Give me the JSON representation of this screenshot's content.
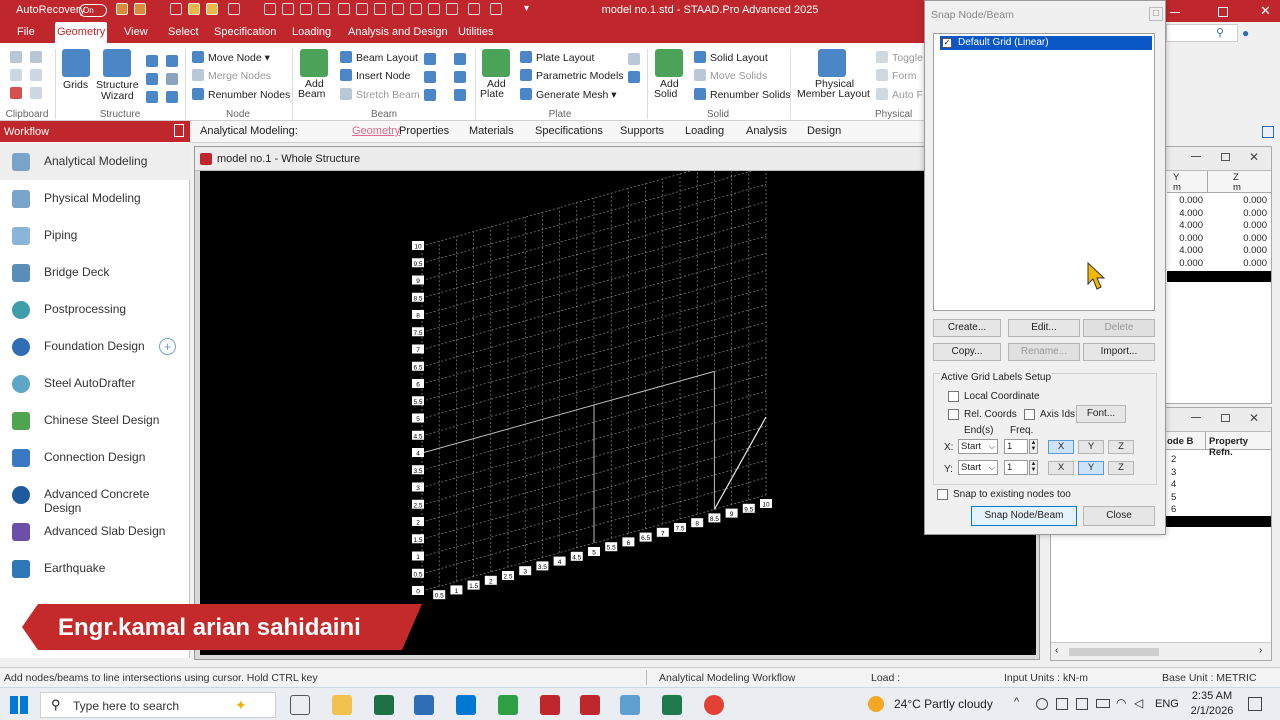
{
  "window": {
    "title": "model no.1.std - STAAD.Pro Advanced 2025",
    "autorecovery_label": "AutoRecovery",
    "autorecovery_state": "On"
  },
  "menu": {
    "tabs": [
      "File",
      "Geometry",
      "View",
      "Select",
      "Specification",
      "Loading",
      "Analysis and Design",
      "Utilities"
    ],
    "active": "Geometry"
  },
  "ribbon": {
    "clipboard": {
      "label": "Clipboard"
    },
    "structure": {
      "label": "Structure",
      "grids": "Grids",
      "wizard_line1": "Structure",
      "wizard_line2": "Wizard"
    },
    "node": {
      "label": "Node",
      "move": "Move Node",
      "merge": "Merge Nodes",
      "renumber": "Renumber Nodes"
    },
    "beam": {
      "label": "Beam",
      "add_line1": "Add",
      "add_line2": "Beam",
      "layout": "Beam Layout",
      "insert": "Insert Node",
      "stretch": "Stretch Beam"
    },
    "plate": {
      "label": "Plate",
      "add_line1": "Add",
      "add_line2": "Plate",
      "layout": "Plate Layout",
      "parametric": "Parametric Models",
      "mesh": "Generate Mesh"
    },
    "solid": {
      "label": "Solid",
      "add_line1": "Add",
      "add_line2": "Solid",
      "layout": "Solid Layout",
      "move": "Move Solids",
      "renumber": "Renumber Solids"
    },
    "physical": {
      "label": "Physical Me",
      "layout_line1": "Physical",
      "layout_line2": "Member Layout",
      "toggle": "Toggle",
      "form": "Form",
      "auto": "Auto F"
    }
  },
  "subtabs": {
    "lead": "Analytical Modeling:",
    "items": [
      "Geometry",
      "Properties",
      "Materials",
      "Specifications",
      "Supports",
      "Loading",
      "Analysis",
      "Design"
    ],
    "active": "Geometry"
  },
  "workflow": {
    "title": "Workflow",
    "items": [
      "Analytical Modeling",
      "Physical Modeling",
      "Piping",
      "Bridge Deck",
      "Postprocessing",
      "Foundation Design",
      "Steel AutoDrafter",
      "Chinese Steel Design",
      "Connection Design",
      "Advanced Concrete Design",
      "Advanced Slab Design",
      "Earthquake"
    ],
    "selected": "Analytical Modeling"
  },
  "banner": {
    "text": "Engr.kamal arian sahidaini"
  },
  "model_window": {
    "title": "model no.1 - Whole Structure",
    "y_labels": [
      "10",
      "9.5",
      "9",
      "8.5",
      "8",
      "7.5",
      "7",
      "6.5",
      "6",
      "5.5",
      "5",
      "4.5",
      "4",
      "3.5",
      "3",
      "2.5",
      "2",
      "1.5",
      "1",
      "0.5",
      "0"
    ],
    "x_labels": [
      "0.5",
      "1",
      "1.5",
      "2",
      "2.5",
      "3",
      "3.5",
      "4",
      "4.5",
      "5",
      "5.5",
      "6",
      "6.5",
      "7",
      "7.5",
      "8",
      "8.5",
      "9",
      "9.5",
      "10"
    ]
  },
  "node_table": {
    "headers": [
      {
        "name": "Y",
        "unit": "m"
      },
      {
        "name": "Z",
        "unit": "m"
      }
    ],
    "rows": [
      [
        "0.000",
        "0.000"
      ],
      [
        "4.000",
        "0.000"
      ],
      [
        "4.000",
        "0.000"
      ],
      [
        "0.000",
        "0.000"
      ],
      [
        "4.000",
        "0.000"
      ],
      [
        "0.000",
        "0.000"
      ]
    ]
  },
  "beam_table": {
    "headers": [
      "ode B",
      "Property Refn."
    ],
    "rows": [
      "2",
      "3",
      "4",
      "5",
      "6"
    ]
  },
  "snap_dialog": {
    "title": "Snap Node/Beam",
    "grid_item": "Default Grid (Linear)",
    "buttons": {
      "create": "Create...",
      "edit": "Edit...",
      "delete": "Delete",
      "copy": "Copy...",
      "rename": "Rename...",
      "import": "Import..."
    },
    "labels_setup": "Active Grid Labels Setup",
    "local_coordinate": "Local Coordinate",
    "rel_coords": "Rel. Coords",
    "axis_ids": "Axis Ids",
    "font": "Font...",
    "ends_header": "End(s)",
    "freq_header": "Freq.",
    "x_row": {
      "axis": "X:",
      "end": "Start",
      "freq": "1"
    },
    "y_row": {
      "axis": "Y:",
      "end": "Start",
      "freq": "1"
    },
    "axis_buttons": [
      "X",
      "Y",
      "Z"
    ],
    "snap_existing": "Snap to existing nodes too",
    "snap_button": "Snap Node/Beam",
    "close_button": "Close"
  },
  "status": {
    "hint": "Add nodes/beams to line intersections using cursor. Hold CTRL key",
    "workflow": "Analytical Modeling Workflow",
    "load": "Load :",
    "input_units": "Input Units : kN-m",
    "base_unit": "Base Unit : METRIC"
  },
  "taskbar": {
    "search_placeholder": "Type here to search",
    "weather": "24°C  Partly cloudy",
    "lang": "ENG",
    "time": "2:35 AM",
    "date": "2/1/2026"
  },
  "colors": {
    "accent": "#c0272d",
    "selection": "#0a58c6",
    "viewport_bg": "#000000"
  }
}
